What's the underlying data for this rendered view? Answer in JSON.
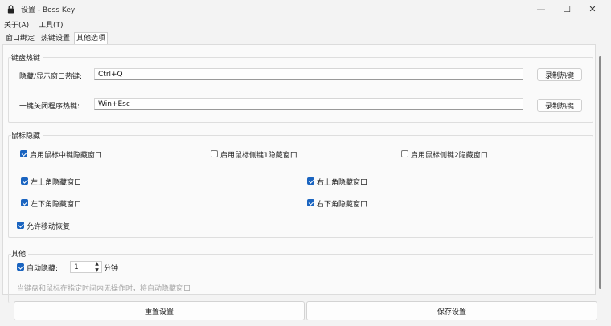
{
  "window": {
    "title": "设置 - Boss Key",
    "minimize_glyph": "—",
    "maximize_glyph": "☐",
    "close_glyph": "✕",
    "icon": "lock-icon"
  },
  "menubar": {
    "items": [
      "关于(A)",
      "工具(T)"
    ]
  },
  "tabs": [
    {
      "label": "窗口绑定"
    },
    {
      "label": "热键设置"
    },
    {
      "label": "其他选项"
    }
  ],
  "hotkeys": {
    "group_title": "键盘热键",
    "rows": [
      {
        "label": "隐藏/显示窗口热键:",
        "value": "Ctrl+Q",
        "button": "录制热键"
      },
      {
        "label": "一键关闭程序热键:",
        "value": "Win+Esc",
        "button": "录制热键"
      }
    ]
  },
  "mouse": {
    "group_title": "鼠标隐藏",
    "options": [
      {
        "label": "启用鼠标中键隐藏窗口",
        "checked": true
      },
      {
        "label": "启用鼠标侧键1隐藏窗口",
        "checked": false
      },
      {
        "label": "启用鼠标侧键2隐藏窗口",
        "checked": false
      }
    ],
    "corners": [
      {
        "label": "左上角隐藏窗口",
        "checked": true
      },
      {
        "label": "右上角隐藏窗口",
        "checked": true
      },
      {
        "label": "左下角隐藏窗口",
        "checked": true
      },
      {
        "label": "右下角隐藏窗口",
        "checked": true
      }
    ],
    "move_restore": {
      "label": "允许移动恢复",
      "checked": true
    }
  },
  "other": {
    "group_title": "其他",
    "auto_hide": {
      "label": "自动隐藏:",
      "checked": true,
      "value": "1",
      "unit": "分钟"
    },
    "hint": "当键盘和鼠标在指定时间内无操作时，将自动隐藏窗口"
  },
  "footer": {
    "reset_label": "重置设置",
    "save_label": "保存设置"
  },
  "colors": {
    "accent": "#1a64c0",
    "background": "#f3f3f3"
  }
}
